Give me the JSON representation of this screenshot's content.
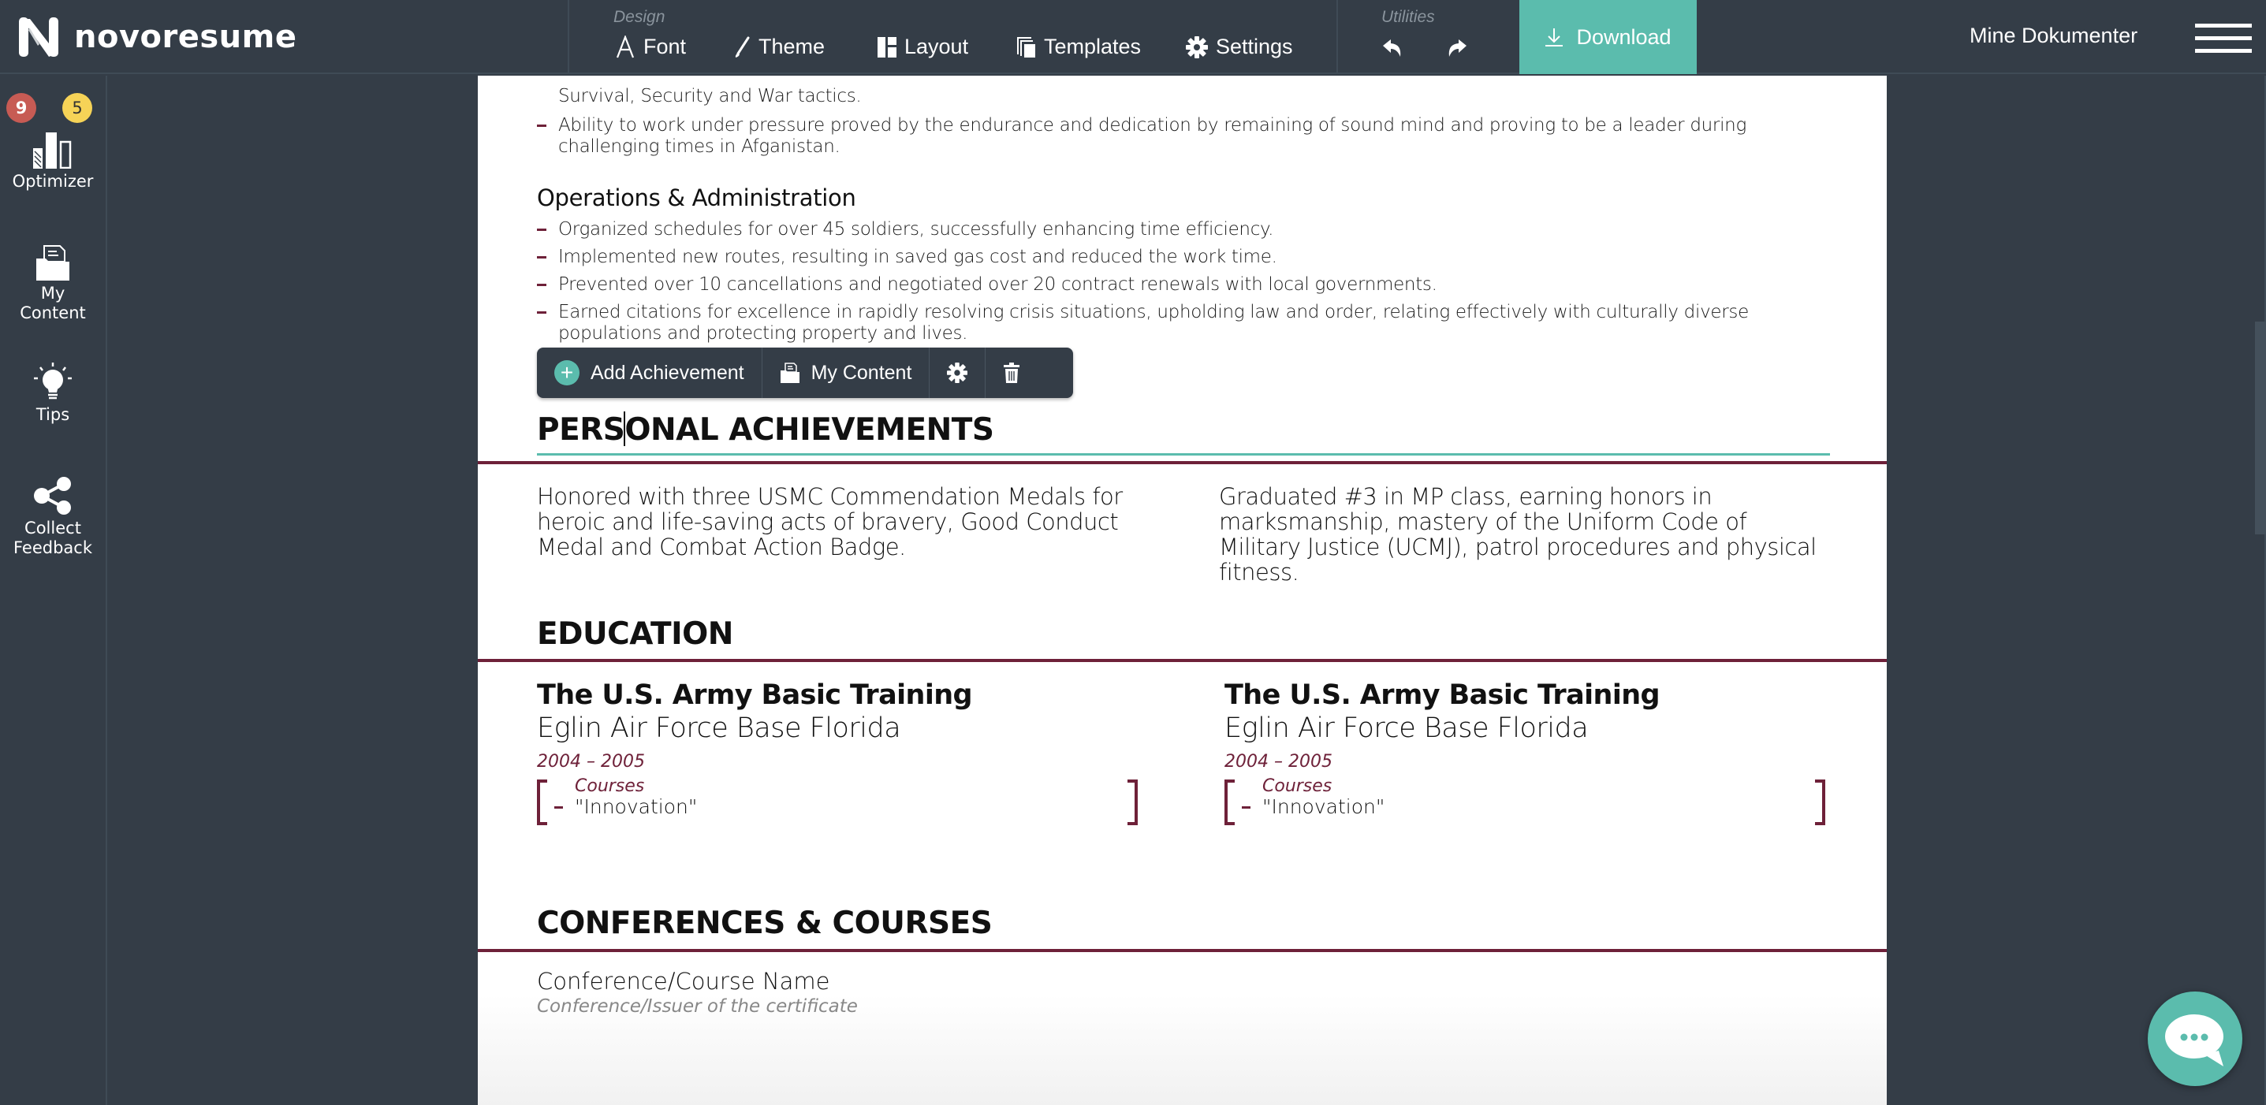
{
  "app": {
    "brand": "novoresume"
  },
  "topbar": {
    "design_label": "Design",
    "design_tools": [
      {
        "label": "Font",
        "icon": "font-icon"
      },
      {
        "label": "Theme",
        "icon": "brush-icon"
      },
      {
        "label": "Layout",
        "icon": "layout-icon"
      },
      {
        "label": "Templates",
        "icon": "templates-icon"
      },
      {
        "label": "Settings",
        "icon": "gear-icon"
      }
    ],
    "utilities_label": "Utilities",
    "download_label": "Download",
    "documents_link": "Mine Dokumenter"
  },
  "sidebar": {
    "badges": {
      "red": "9",
      "yellow": "5"
    },
    "items": [
      {
        "label_1": "Optimizer",
        "label_2": ""
      },
      {
        "label_1": "My",
        "label_2": "Content"
      },
      {
        "label_1": "Tips",
        "label_2": ""
      },
      {
        "label_1": "Collect",
        "label_2": "Feedback"
      }
    ]
  },
  "resume": {
    "partial_bullet_tail": "Survival, Security and War tactics.",
    "skills_bullets": [
      "Ability to work under pressure proved by the endurance and dedication by remaining of sound mind and proving to be a leader during challenging times in Afganistan."
    ],
    "ops_title": "Operations & Administration",
    "ops_bullets": [
      "Organized schedules for over 45 soldiers, successfully enhancing time efficiency.",
      "Implemented new routes, resulting in saved gas cost and reduced the work time.",
      "Prevented over 10 cancellations and negotiated over 20 contract renewals with local governments.",
      "Earned citations for excellence in rapidly resolving crisis situations, upholding law and order, relating effectively with culturally diverse populations and protecting property and lives."
    ],
    "block_toolbar": {
      "add_label": "Add Achievement",
      "my_content_label": "My Content"
    },
    "achievements": {
      "title_before_cursor": "PERS",
      "title_after_cursor": "ONAL ACHIEVEMENTS",
      "items": [
        "Honored with three USMC Commendation Medals for heroic and life-saving acts of bravery, Good Conduct Medal and Combat Action Badge.",
        "Graduated #3 in MP class, earning honors in marksmanship, mastery of the Uniform Code of Military Justice (UCMJ), patrol procedures and physical fitness."
      ]
    },
    "education": {
      "title": "EDUCATION",
      "entries": [
        {
          "degree": "The U.S. Army Basic Training",
          "school": "Eglin Air Force Base Florida",
          "dates": "2004 – 2005",
          "courses_label": "Courses",
          "courses": [
            "\"Innovation\""
          ]
        },
        {
          "degree": "The U.S. Army Basic Training",
          "school": "Eglin Air Force Base Florida",
          "dates": "2004 – 2005",
          "courses_label": "Courses",
          "courses": [
            "\"Innovation\""
          ]
        }
      ]
    },
    "conferences": {
      "title": "CONFERENCES & COURSES",
      "name_placeholder": "Conference/Course Name",
      "issuer_placeholder": "Conference/Issuer of the certificate"
    }
  },
  "colors": {
    "accent": "#5bbcad",
    "maroon": "#6e2139",
    "chrome": "#343d47",
    "badge_red": "#c75b54",
    "badge_yellow": "#f6d357"
  }
}
